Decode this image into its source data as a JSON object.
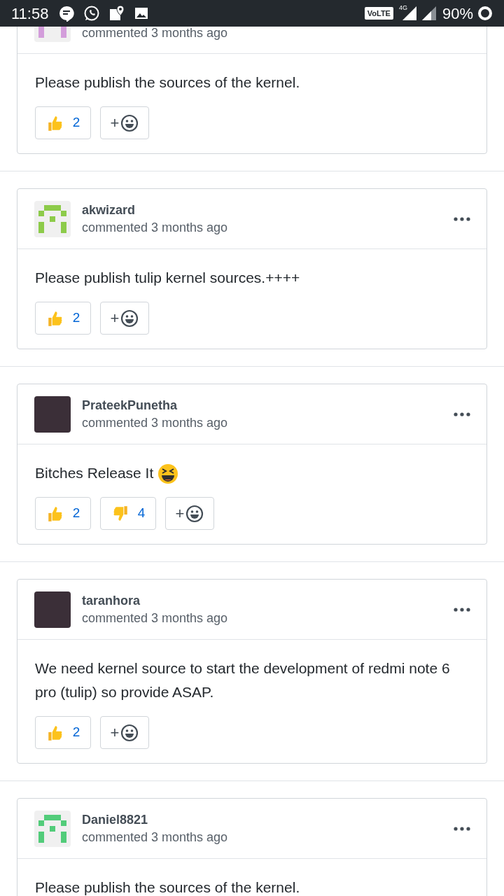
{
  "status_bar": {
    "time": "11:58",
    "volte": "VoLTE",
    "network": "4G",
    "battery": "90%"
  },
  "add_reaction_label": "+",
  "comments": [
    {
      "avatar": {
        "kind": "identicon",
        "color": "#d39ddb"
      },
      "meta": "commented 3 months ago",
      "more_menu": false,
      "body": [
        {
          "kind": "text",
          "text": "Please publish the sources of the kernel."
        }
      ],
      "reactions": [
        {
          "kind": "thumbs_up",
          "count": "2"
        }
      ]
    },
    {
      "avatar": {
        "kind": "identicon",
        "color": "#8dcb4a"
      },
      "author": "akwizard",
      "meta": "commented 3 months ago",
      "more_menu": true,
      "body": [
        {
          "kind": "text",
          "text": "Please publish tulip kernel sources.++++"
        }
      ],
      "reactions": [
        {
          "kind": "thumbs_up",
          "count": "2"
        }
      ]
    },
    {
      "avatar": {
        "kind": "photo"
      },
      "author": "PrateekPunetha",
      "meta": "commented 3 months ago",
      "more_menu": true,
      "body": [
        {
          "kind": "text",
          "text": "Bitches Release It"
        },
        {
          "kind": "emoji"
        }
      ],
      "reactions": [
        {
          "kind": "thumbs_up",
          "count": "2"
        },
        {
          "kind": "thumbs_down",
          "count": "4"
        }
      ]
    },
    {
      "avatar": {
        "kind": "photo"
      },
      "author": "taranhora",
      "meta": "commented 3 months ago",
      "more_menu": true,
      "body": [
        {
          "kind": "text",
          "text": "We need kernel source to start the development of redmi note 6 pro (tulip) so provide ASAP."
        }
      ],
      "reactions": [
        {
          "kind": "thumbs_up",
          "count": "2"
        }
      ]
    },
    {
      "avatar": {
        "kind": "identicon",
        "color": "#52cc7a"
      },
      "author": "Daniel8821",
      "meta": "commented 3 months ago",
      "more_menu": true,
      "body": [
        {
          "kind": "text",
          "text": "Please publish the sources of the kernel."
        }
      ]
    }
  ]
}
